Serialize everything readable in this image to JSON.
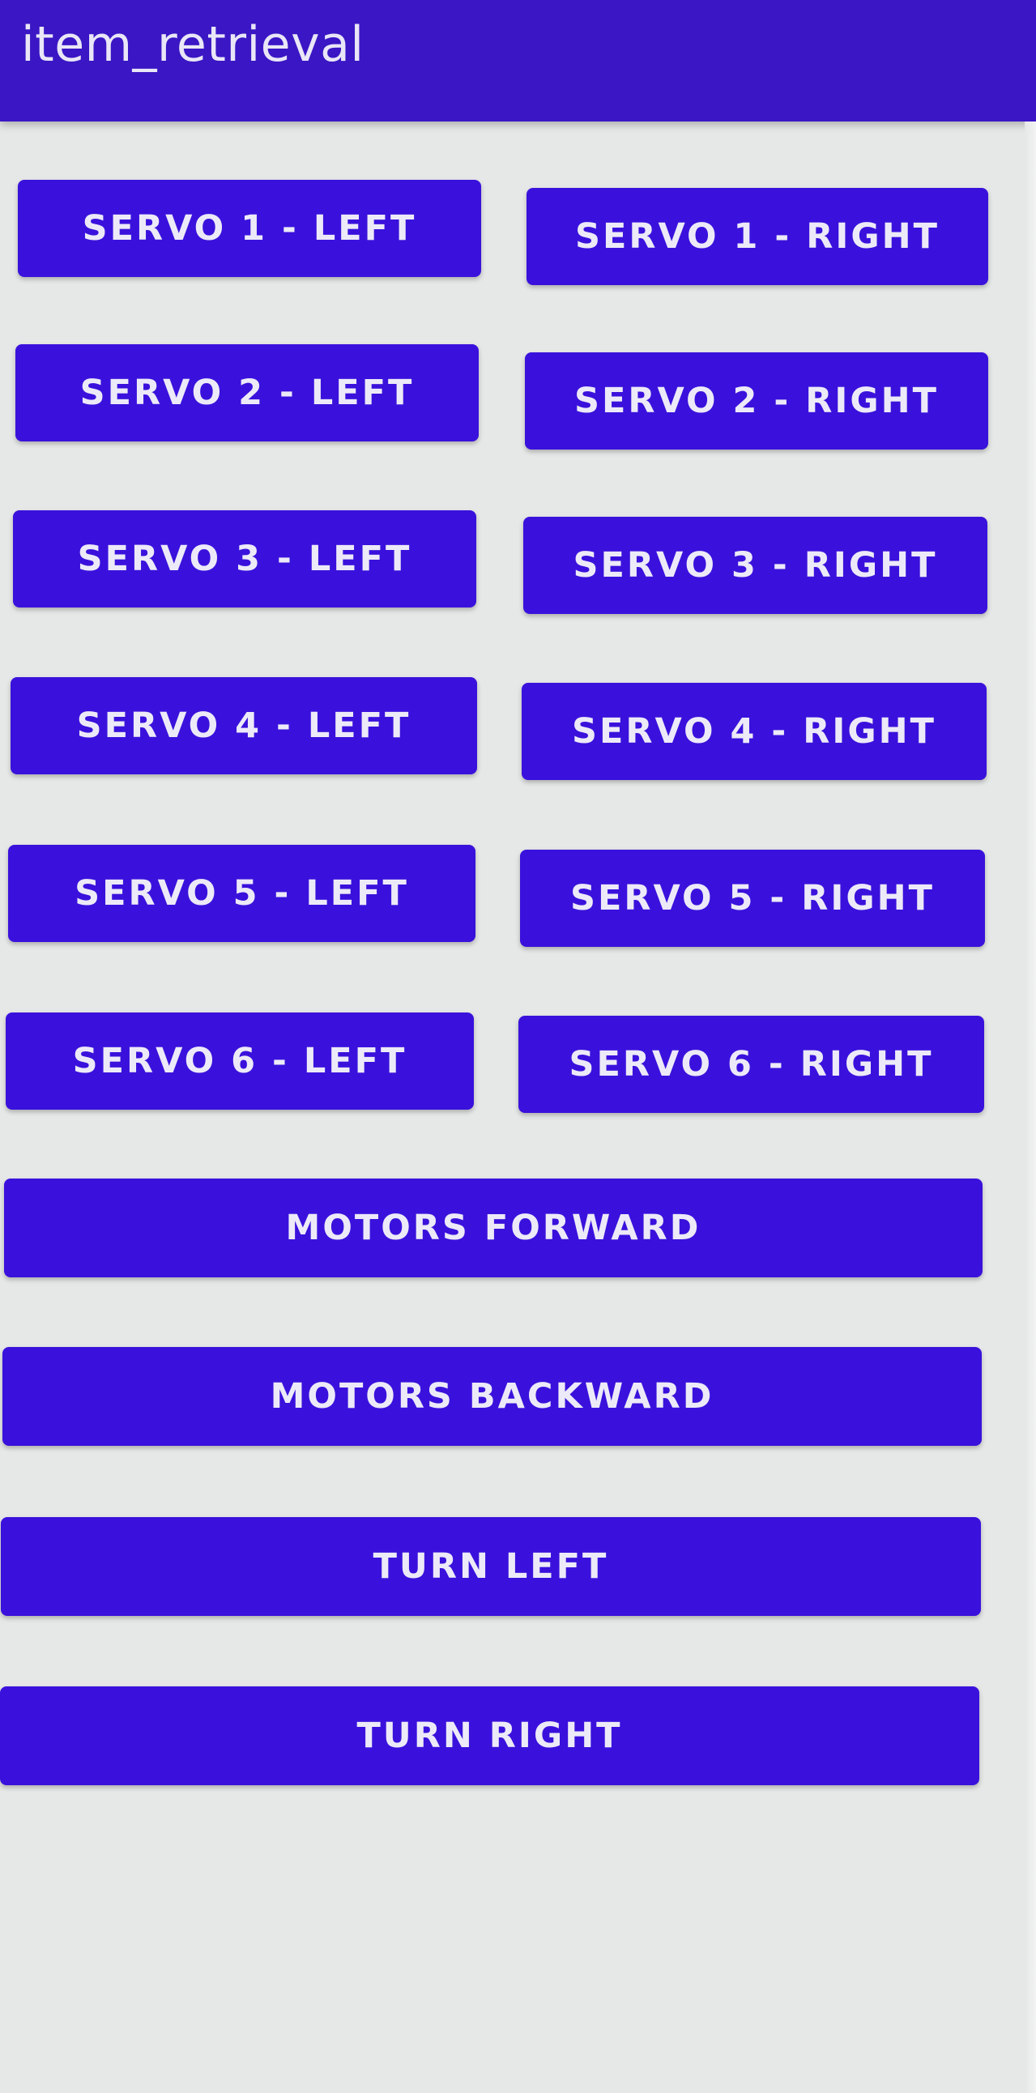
{
  "app_bar": {
    "title": "item_retrieval"
  },
  "servo_rows": [
    {
      "left_label": "SERVO 1 - LEFT",
      "right_label": "SERVO 1 - RIGHT"
    },
    {
      "left_label": "SERVO 2 - LEFT",
      "right_label": "SERVO 2 - RIGHT"
    },
    {
      "left_label": "SERVO 3 - LEFT",
      "right_label": "SERVO 3 - RIGHT"
    },
    {
      "left_label": "SERVO 4 - LEFT",
      "right_label": "SERVO 4 - RIGHT"
    },
    {
      "left_label": "SERVO 5 - LEFT",
      "right_label": "SERVO 5 - RIGHT"
    },
    {
      "left_label": "SERVO 6 - LEFT",
      "right_label": "SERVO 6 - RIGHT"
    }
  ],
  "motion_buttons": {
    "motors_forward": "MOTORS FORWARD",
    "motors_backward": "MOTORS BACKWARD",
    "turn_left": "TURN LEFT",
    "turn_right": "TURN RIGHT"
  },
  "colors": {
    "app_bar": "#3a16c4",
    "button": "#3a11dc",
    "button_text": "#eceaf8",
    "background": "#e6e8e8"
  }
}
